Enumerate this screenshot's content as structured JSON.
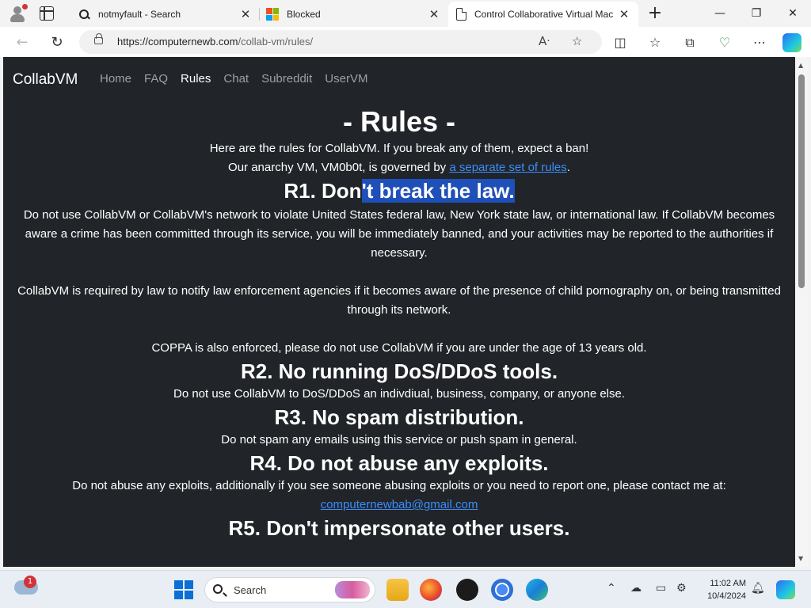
{
  "browser": {
    "tabs": [
      {
        "title": "notmyfault - Search",
        "favicon": "search-icon"
      },
      {
        "title": "Blocked",
        "favicon": "microsoft-logo-icon"
      },
      {
        "title": "Control Collaborative Virtual Mac",
        "favicon": "page-icon",
        "active": true
      }
    ],
    "url": {
      "host": "https://computernewb.com",
      "path": "/collab-vm/rules/"
    }
  },
  "site": {
    "brand": "CollabVM",
    "nav": [
      "Home",
      "FAQ",
      "Rules",
      "Chat",
      "Subreddit",
      "UserVM"
    ],
    "active_nav": "Rules"
  },
  "page": {
    "title": "- Rules -",
    "intro_line1": "Here are the rules for CollabVM. If you break any of them, expect a ban!",
    "intro_line2_prefix": "Our anarchy VM, VM0b0t, is governed by ",
    "intro_line2_link": "a separate set of rules",
    "intro_line2_suffix": ".",
    "rules": [
      {
        "heading_pre": "R1. Don",
        "heading_sel": "'t break the law.",
        "paras": [
          "Do not use CollabVM or CollabVM's network to violate United States federal law, New York state law, or international law. If CollabVM becomes aware a crime has been committed through its service, you will be immediately banned, and your activities may be reported to the authorities if necessary.",
          "CollabVM is required by law to notify law enforcement agencies if it becomes aware of the presence of child pornography on, or being transmitted through its network.",
          "COPPA is also enforced, please do not use CollabVM if you are under the age of 13 years old."
        ]
      },
      {
        "heading": "R2. No running DoS/DDoS tools.",
        "para": "Do not use CollabVM to DoS/DDoS an indivdiual, business, company, or anyone else."
      },
      {
        "heading": "R3. No spam distribution.",
        "para": "Do not spam any emails using this service or push spam in general."
      },
      {
        "heading": "R4. Do not abuse any exploits.",
        "para": "Do not abuse any exploits, additionally if you see someone abusing exploits or you need to report one, please contact me at:",
        "email": "computernewbab@gmail.com"
      },
      {
        "heading": "R5. Don't impersonate other users."
      }
    ]
  },
  "taskbar": {
    "search_label": "Search",
    "weather_badge": "1",
    "time": "11:02 AM",
    "date": "10/4/2024"
  }
}
